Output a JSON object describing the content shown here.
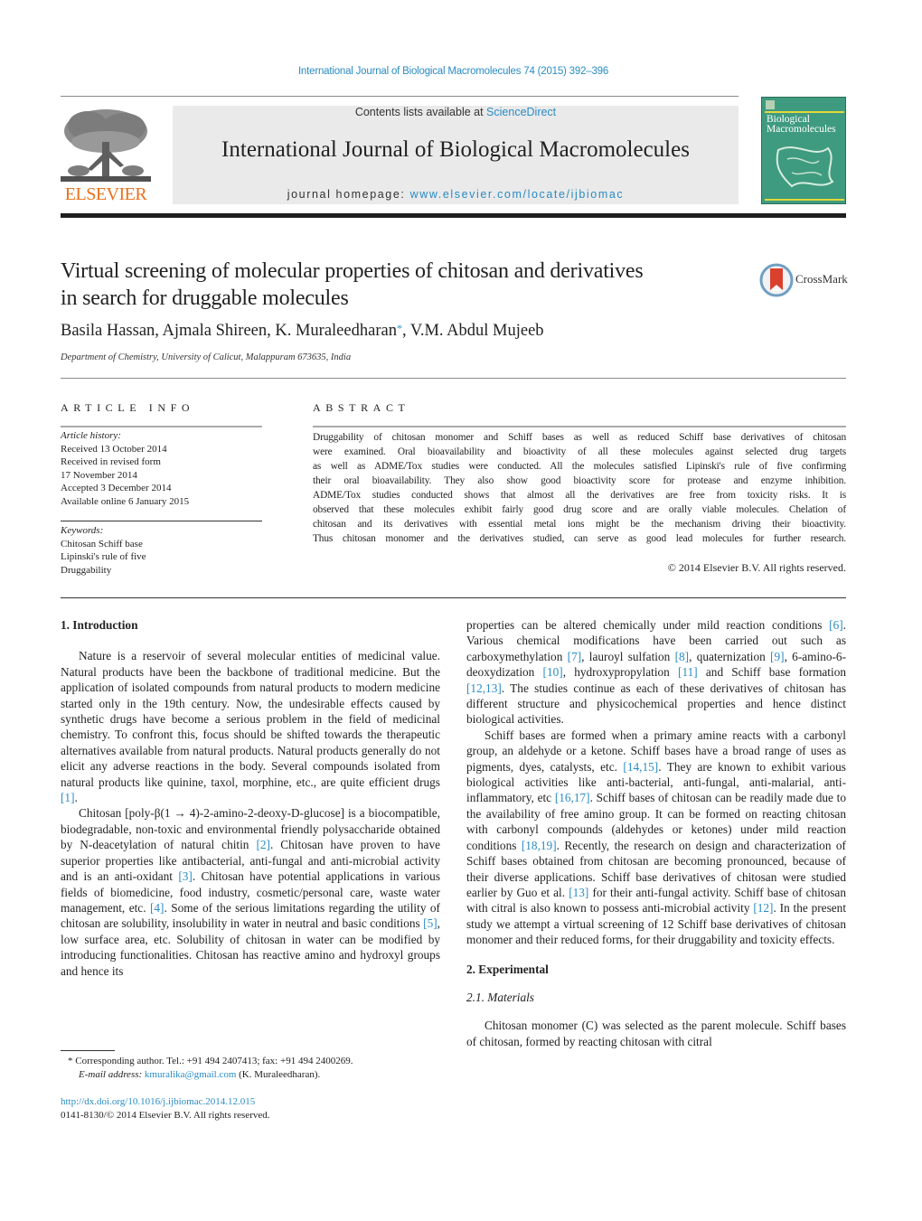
{
  "running_header": "International Journal of Biological Macromolecules 74 (2015) 392–396",
  "banner": {
    "publisher_logo_text": "ELSEVIER",
    "contents_prefix": "Contents lists available at ",
    "contents_link": "ScienceDirect",
    "journal_name": "International Journal of Biological Macromolecules",
    "homepage_prefix": "journal homepage: ",
    "homepage_link": "www.elsevier.com/locate/ijbiomac",
    "cover_title_line1": "Biological",
    "cover_title_line2": "Macromolecules"
  },
  "article": {
    "title_line1": "Virtual screening of molecular properties of chitosan and derivatives",
    "title_line2": "in search for druggable molecules",
    "crossmark_label": "CrossMark",
    "authors_main": "Basila Hassan, Ajmala Shireen, K. Muraleedharan",
    "corresponding_mark": "*",
    "authors_tail": ", V.M. Abdul Mujeeb",
    "affiliation": "Department of Chemistry, University of Calicut, Malappuram 673635, India"
  },
  "article_info": {
    "heading": "ARTICLE INFO",
    "history_label": "Article history:",
    "history": [
      "Received 13 October 2014",
      "Received in revised form",
      "17 November 2014",
      "Accepted 3 December 2014",
      "Available online 6 January 2015"
    ],
    "keywords_label": "Keywords:",
    "keywords": [
      "Chitosan Schiff base",
      "Lipinski's rule of five",
      "Druggability"
    ]
  },
  "abstract": {
    "heading": "ABSTRACT",
    "lines": [
      "Druggability of chitosan monomer and Schiff bases as well as reduced Schiff base derivatives of chitosan",
      "were examined. Oral bioavailability and bioactivity of all these molecules against selected drug targets",
      "as well as ADME/Tox studies were conducted. All the molecules satisfied Lipinski's rule of five confirming",
      "their oral bioavailability. They also show good bioactivity score for protease and enzyme inhibition.",
      "ADME/Tox studies conducted shows that almost all the derivatives are free from toxicity risks. It is",
      "observed that these molecules exhibit fairly good drug score and are orally viable molecules. Chelation of",
      "chitosan and its derivatives with essential metal ions might be the mechanism driving their bioactivity.",
      "Thus chitosan monomer and the derivatives studied, can serve as good lead molecules for further research."
    ],
    "copyright": "© 2014 Elsevier B.V. All rights reserved."
  },
  "body": {
    "intro_heading": "1.  Introduction",
    "intro_p1": [
      {
        "t": "Nature is a reservoir of several molecular entities of medicinal value. Natural products have been the backbone of traditional medicine. But the application of isolated compounds from natural products to modern medicine started only in the 19th century. Now, the undesirable effects caused by synthetic drugs have become a serious problem in the field of medicinal chemistry. To confront this, focus should be shifted towards the therapeutic alternatives available from natural products. Natural products generally do not elicit any adverse reactions in the body. Several compounds isolated from natural products like quinine, taxol, morphine, etc., are quite efficient drugs "
      },
      {
        "ref": "[1]"
      },
      {
        "t": "."
      }
    ],
    "intro_p2": [
      {
        "t": "Chitosan [poly-β(1 → 4)-2-amino-2-deoxy-D-glucose] is a biocompatible, biodegradable, non-toxic and environmental friendly polysaccharide obtained by N-deacetylation of natural chitin "
      },
      {
        "ref": "[2]"
      },
      {
        "t": ". Chitosan have proven to have superior properties like antibacterial, anti-fungal and anti-microbial activity and is an anti-oxidant "
      },
      {
        "ref": "[3]"
      },
      {
        "t": ". Chitosan have potential applications in various fields of biomedicine, food industry, cosmetic/personal care, waste water management, etc. "
      },
      {
        "ref": "[4]"
      },
      {
        "t": ". Some of the serious limitations regarding the utility of chitosan are solubility, insolubility in water in neutral and basic conditions "
      },
      {
        "ref": "[5]"
      },
      {
        "t": ", low surface area, etc. Solubility of chitosan in water can be modified by introducing functionalities. Chitosan has reactive amino and hydroxyl groups and hence its"
      }
    ],
    "right_p1": [
      {
        "t": "properties can be altered chemically under mild reaction conditions "
      },
      {
        "ref": "[6]"
      },
      {
        "t": ". Various chemical modifications have been carried out such as carboxymethylation "
      },
      {
        "ref": "[7]"
      },
      {
        "t": ", lauroyl sulfation "
      },
      {
        "ref": "[8]"
      },
      {
        "t": ", quaternization "
      },
      {
        "ref": "[9]"
      },
      {
        "t": ", 6-amino-6-deoxydization "
      },
      {
        "ref": "[10]"
      },
      {
        "t": ", hydroxypropylation "
      },
      {
        "ref": "[11]"
      },
      {
        "t": " and Schiff base formation "
      },
      {
        "ref": "[12,13]"
      },
      {
        "t": ". The studies continue as each of these derivatives of chitosan has different structure and physicochemical properties and hence distinct biological activities."
      }
    ],
    "right_p2": [
      {
        "t": "Schiff bases are formed when a primary amine reacts with a carbonyl group, an aldehyde or a ketone. Schiff bases have a broad range of uses as pigments, dyes, catalysts, etc. "
      },
      {
        "ref": "[14,15]"
      },
      {
        "t": ". They are known to exhibit various biological activities like anti-bacterial, anti-fungal, anti-malarial, anti-inflammatory, etc "
      },
      {
        "ref": "[16,17]"
      },
      {
        "t": ". Schiff bases of chitosan can be readily made due to the availability of free amino group. It can be formed on reacting chitosan with carbonyl compounds (aldehydes or ketones) under mild reaction conditions "
      },
      {
        "ref": "[18,19]"
      },
      {
        "t": ". Recently, the research on design and characterization of Schiff bases obtained from chitosan are becoming pronounced, because of their diverse applications. Schiff base derivatives of chitosan were studied earlier by Guo et al. "
      },
      {
        "ref": "[13]"
      },
      {
        "t": " for their anti-fungal activity. Schiff base of chitosan with citral is also known to possess anti-microbial activity "
      },
      {
        "ref": "[12]"
      },
      {
        "t": ". In the present study we attempt a virtual screening of 12 Schiff base derivatives of chitosan monomer and their reduced forms, for their druggability and toxicity effects."
      }
    ],
    "experimental_heading": "2.  Experimental",
    "materials_heading": "2.1.  Materials",
    "materials_p1": "Chitosan monomer (C) was selected as the parent molecule. Schiff bases of chitosan, formed by reacting chitosan with citral"
  },
  "footnote": {
    "mark": "*",
    "line1": " Corresponding author. Tel.: +91 494 2407413; fax: +91 494 2400269.",
    "email_label": "E-mail address: ",
    "email": "kmuralika@gmail.com",
    "email_suffix": " (K. Muraleedharan).",
    "doi": "http://dx.doi.org/10.1016/j.ijbiomac.2014.12.015",
    "issn_line": "0141-8130/© 2014 Elsevier B.V. All rights reserved."
  },
  "colors": {
    "link": "#2a8cc4",
    "elsevier_orange": "#e9711c",
    "cover_green": "#3f9b7f",
    "crossmark_red": "#d9412d"
  }
}
